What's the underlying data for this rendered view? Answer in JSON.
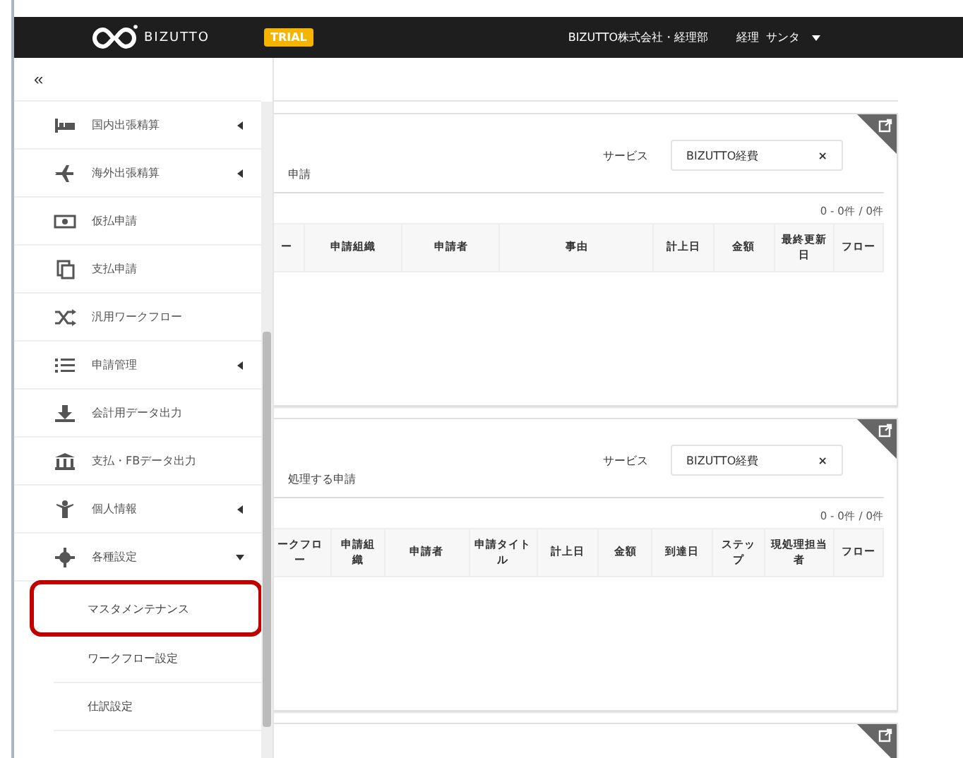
{
  "header": {
    "logo": "BIZUTTO",
    "badge": "TRIAL",
    "company": "BIZUTTO株式会社・経理部",
    "user": "経理",
    "user_name": "サンタ"
  },
  "sidebar": {
    "collapse": "«",
    "items": [
      {
        "label": "国内出張精算",
        "kind": "group",
        "expanded": false
      },
      {
        "label": "海外出張精算",
        "kind": "group",
        "expanded": false
      },
      {
        "label": "仮払申請",
        "kind": "link"
      },
      {
        "label": "支払申請",
        "kind": "link"
      },
      {
        "label": "汎用ワークフロー",
        "kind": "link"
      },
      {
        "label": "申請管理",
        "kind": "group",
        "expanded": false
      },
      {
        "label": "会計用データ出力",
        "kind": "link"
      },
      {
        "label": "支払・FBデータ出力",
        "kind": "link"
      },
      {
        "label": "個人情報",
        "kind": "group",
        "expanded": false
      },
      {
        "label": "各種設定",
        "kind": "group",
        "expanded": true,
        "children": [
          {
            "label": "マスタメンテナンス",
            "highlighted": true
          },
          {
            "label": "ワークフロー設定",
            "highlighted": false
          },
          {
            "label": "仕訳設定",
            "highlighted": false
          }
        ]
      }
    ]
  },
  "panels": [
    {
      "title": "申請",
      "service_label": "サービス",
      "service_value": "BIZUTTO経費",
      "clear": "×",
      "count": "0 - 0件 / 0件",
      "columns": [
        "ー",
        "申請組織",
        "申請者",
        "事由",
        "計上日",
        "金額",
        "最終更新日",
        "フロー"
      ]
    },
    {
      "title": "処理する申請",
      "service_label": "サービス",
      "service_value": "BIZUTTO経費",
      "clear": "×",
      "count": "0 - 0件 / 0件",
      "columns": [
        "ークフロー",
        "申請組織",
        "申請者",
        "申請タイトル",
        "計上日",
        "金額",
        "到達日",
        "ステップ",
        "現処理担当者",
        "フロー"
      ]
    }
  ]
}
